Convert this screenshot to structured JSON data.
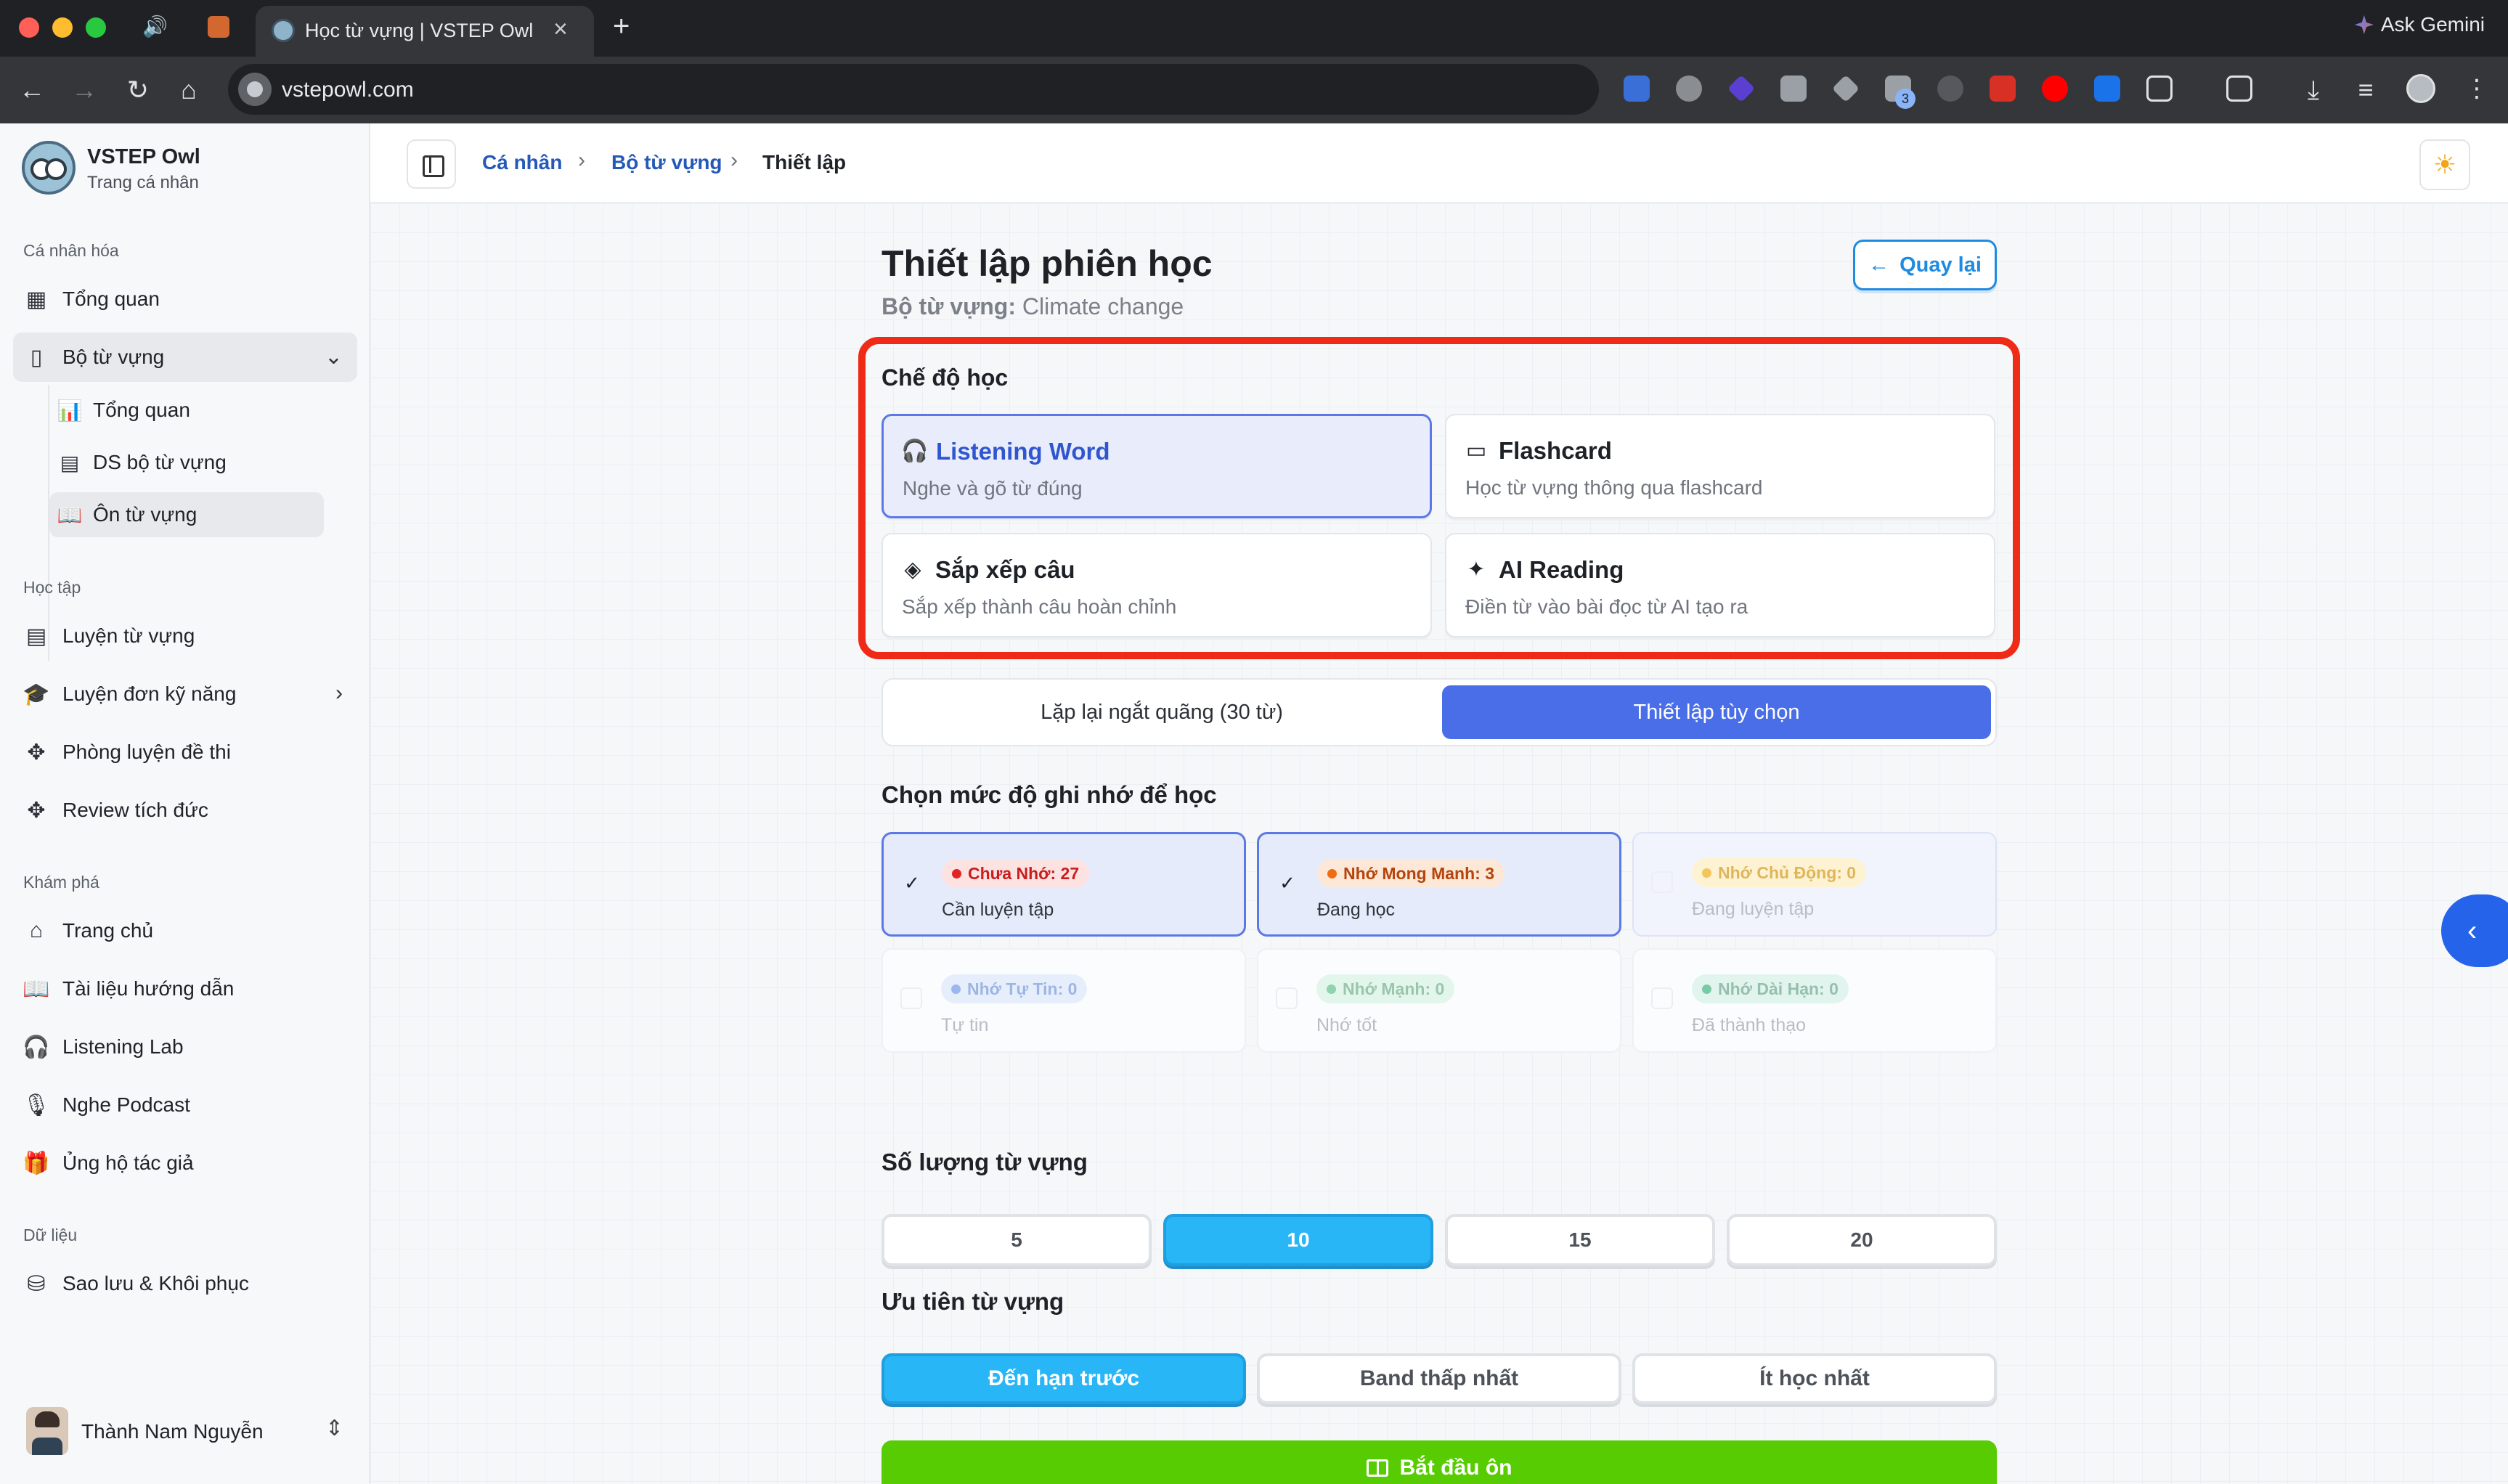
{
  "browser": {
    "tab_title": "Học từ vựng | VSTEP Owl",
    "url": "vstepowl.com",
    "ask_gemini": "Ask Gemini",
    "ext_badge_count": "3"
  },
  "sidebar": {
    "brand_name": "VSTEP Owl",
    "brand_sub": "Trang cá nhân",
    "sections": {
      "personal": "Cá nhân hóa",
      "study": "Học tập",
      "explore": "Khám phá",
      "data": "Dữ liệu"
    },
    "items": {
      "overview": "Tổng quan",
      "vocab_set": "Bộ từ vựng",
      "sub_overview": "Tổng quan",
      "sub_list": "DS bộ từ vựng",
      "sub_review": "Ôn từ vựng",
      "practice_vocab": "Luyện từ vựng",
      "practice_skill": "Luyện đơn kỹ năng",
      "exam_room": "Phòng luyện đề thi",
      "review": "Review tích đức",
      "home": "Trang chủ",
      "docs": "Tài liệu hướng dẫn",
      "listening_lab": "Listening Lab",
      "podcast": "Nghe Podcast",
      "support": "Ủng hộ tác giả",
      "backup": "Sao lưu & Khôi phục"
    },
    "user_name": "Thành Nam Nguyễn"
  },
  "breadcrumb": {
    "items": [
      "Cá nhân",
      "Bộ từ vựng",
      "Thiết lập"
    ]
  },
  "main": {
    "title": "Thiết lập phiên học",
    "subtitle_label": "Bộ từ vựng:",
    "subtitle_value": "Climate change",
    "back_label": "Quay lại",
    "mode_heading": "Chế độ học",
    "modes": [
      {
        "title": "Listening Word",
        "desc": "Nghe và gõ từ đúng",
        "icon": "headphones-icon",
        "selected": true
      },
      {
        "title": "Flashcard",
        "desc": "Học từ vựng thông qua flashcard",
        "icon": "card-icon",
        "selected": false
      },
      {
        "title": "Sắp xếp câu",
        "desc": "Sắp xếp thành câu hoàn chỉnh",
        "icon": "layers-icon",
        "selected": false
      },
      {
        "title": "AI Reading",
        "desc": "Điền từ vào bài đọc từ AI tạo ra",
        "icon": "sparkles-icon",
        "selected": false
      }
    ],
    "segment": {
      "option_1": "Lặp lại ngắt quãng (30 từ)",
      "option_2": "Thiết lập tùy chọn",
      "selected": "option_2"
    },
    "level_heading": "Chọn mức độ ghi nhớ để học",
    "levels": [
      {
        "badge": "Chưa Nhớ: 27",
        "desc": "Cần luyện tập",
        "selected": true
      },
      {
        "badge": "Nhớ Mong Manh: 3",
        "desc": "Đang học",
        "selected": true
      },
      {
        "badge": "Nhớ Chủ Động: 0",
        "desc": "Đang luyện tập",
        "selected": false
      },
      {
        "badge": "Nhớ Tự Tin: 0",
        "desc": "Tự tin",
        "selected": false
      },
      {
        "badge": "Nhớ Mạnh: 0",
        "desc": "Nhớ tốt",
        "selected": false
      },
      {
        "badge": "Nhớ Dài Hạn: 0",
        "desc": "Đã thành thạo",
        "selected": false
      }
    ],
    "quantity_heading": "Số lượng từ vựng",
    "quantities": [
      "5",
      "10",
      "15",
      "20"
    ],
    "quantity_selected": "10",
    "priority_heading": "Ưu tiên từ vựng",
    "priorities": [
      "Đến hạn trước",
      "Band thấp nhất",
      "Ít học nhất"
    ],
    "priority_selected": "Đến hạn trước",
    "start_label": "Bắt đầu ôn"
  },
  "colors": {
    "accent_blue": "#4a6ee8",
    "highlight_red": "#ef2a17",
    "start_green": "#58cc02",
    "quantity_blue": "#29b6f6"
  }
}
